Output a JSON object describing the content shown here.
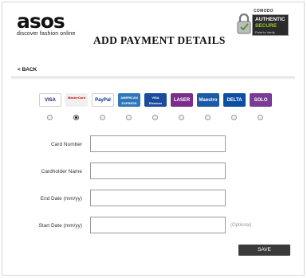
{
  "brand": {
    "logo_text": "asos",
    "tagline": "discover fashion online"
  },
  "page": {
    "title": "ADD PAYMENT DETAILS",
    "back_label": "< BACK"
  },
  "seal": {
    "brand": "COMODO",
    "line1": "AUTHENTIC",
    "line2": "SECURE",
    "line3": "Point to Verify"
  },
  "payment_methods": [
    {
      "name": "VISA",
      "label": "VISA",
      "selected": false,
      "bg": "#ffffff",
      "fg": "#1a1f71"
    },
    {
      "name": "Mastercard",
      "label": "MasterCard",
      "selected": true,
      "bg": "#f0f0f0",
      "fg": "#cc0000"
    },
    {
      "name": "PayPal",
      "label": "PayPal",
      "selected": false,
      "bg": "#ffffff",
      "fg": "#003087"
    },
    {
      "name": "American Express",
      "label": "AMERICAN EXPRESS",
      "selected": false,
      "bg": "#2e77bb",
      "fg": "#ffffff"
    },
    {
      "name": "Visa Electron",
      "label": "VISA Electron",
      "selected": false,
      "bg": "#1a4b9c",
      "fg": "#ffffff"
    },
    {
      "name": "Laser",
      "label": "LASER",
      "selected": false,
      "bg": "#7b2d8b",
      "fg": "#ffffff"
    },
    {
      "name": "Maestro",
      "label": "Maestro",
      "selected": false,
      "bg": "#1c5aa6",
      "fg": "#ffffff"
    },
    {
      "name": "Delta",
      "label": "DELTA",
      "selected": false,
      "bg": "#0d4ea2",
      "fg": "#ffffff"
    },
    {
      "name": "Solo",
      "label": "SOLO",
      "selected": false,
      "bg": "#7a3b97",
      "fg": "#ffffff"
    }
  ],
  "form": {
    "card_number": {
      "label": "Card Number",
      "value": ""
    },
    "cardholder_name": {
      "label": "Cardholder Name",
      "value": ""
    },
    "end_date": {
      "label": "End Date (mm/yy)",
      "value": ""
    },
    "start_date": {
      "label": "Start Date (mm/yy)",
      "value": "",
      "hint": "(Optional)"
    }
  },
  "actions": {
    "save_label": "SAVE"
  },
  "colors": {
    "button_bg": "#3a3a3a",
    "seal_green": "#9acd32"
  }
}
